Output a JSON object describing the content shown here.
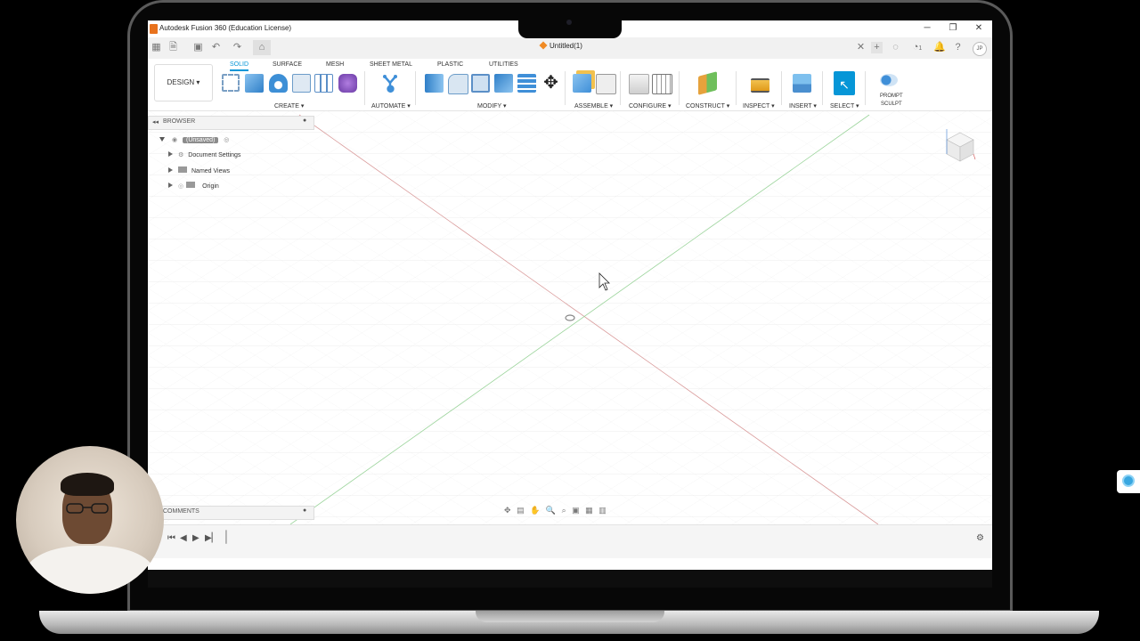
{
  "window": {
    "title": "Autodesk Fusion 360 (Education License)",
    "minimize": "─",
    "restore": "❐",
    "close": "✕"
  },
  "document": {
    "tab_title": "Untitled(1)",
    "close_tab": "✕",
    "avatar_initials": "JP",
    "jobs_count": "1"
  },
  "ribbon": {
    "workspace": "DESIGN ▾",
    "tabs": [
      "SOLID",
      "SURFACE",
      "MESH",
      "SHEET METAL",
      "PLASTIC",
      "UTILITIES"
    ],
    "groups": {
      "create": "CREATE ▾",
      "automate": "AUTOMATE ▾",
      "modify": "MODIFY ▾",
      "assemble": "ASSEMBLE ▾",
      "configure": "CONFIGURE ▾",
      "construct": "CONSTRUCT ▾",
      "inspect": "INSPECT ▾",
      "insert": "INSERT ▾",
      "select": "SELECT ▾",
      "prompt_line1": "PROMPT",
      "prompt_line2": "SCULPT"
    }
  },
  "browser": {
    "title": "BROWSER",
    "root": "(Unsaved)",
    "items": [
      "Document Settings",
      "Named Views",
      "Origin"
    ]
  },
  "comments": {
    "title": "COMMENTS"
  },
  "colors": {
    "accent": "#0696d7",
    "axis_red": "#d99a9a",
    "axis_green": "#9bd49b",
    "grid": "#e6e6e6"
  }
}
